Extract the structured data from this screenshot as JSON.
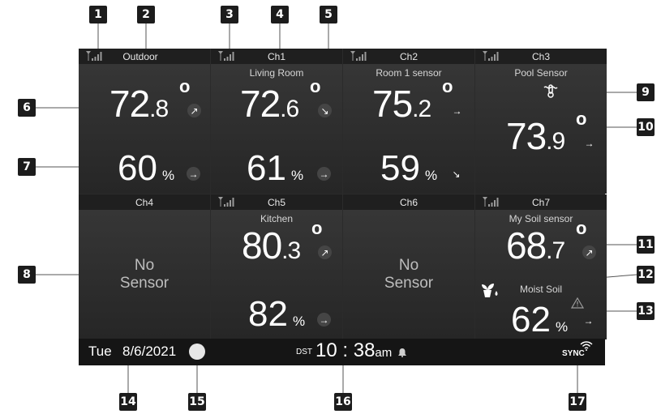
{
  "callouts": [
    "1",
    "2",
    "3",
    "4",
    "5",
    "6",
    "7",
    "8",
    "9",
    "10",
    "11",
    "12",
    "13",
    "14",
    "15",
    "16",
    "17"
  ],
  "cells": [
    {
      "channel": "Outdoor",
      "subtitle": "",
      "temp_int": "72",
      "temp_dec": ".8",
      "temp_trend": "↗",
      "hum": "60",
      "hum_unit": "%",
      "hum_trend": "→"
    },
    {
      "channel": "Ch1",
      "subtitle": "Living Room",
      "temp_int": "72",
      "temp_dec": ".6",
      "temp_trend": "↘",
      "hum": "61",
      "hum_unit": "%",
      "hum_trend": "→"
    },
    {
      "channel": "Ch2",
      "subtitle": "Room 1 sensor",
      "temp_int": "75",
      "temp_dec": ".2",
      "temp_trend": "→",
      "hum": "59",
      "hum_unit": "%",
      "hum_trend": "↘"
    },
    {
      "channel": "Ch3",
      "subtitle": "Pool Sensor",
      "temp_int": "73",
      "temp_dec": ".9",
      "temp_trend": "→"
    },
    {
      "channel": "Ch4",
      "nosensor_1": "No",
      "nosensor_2": "Sensor"
    },
    {
      "channel": "Ch5",
      "subtitle": "Kitchen",
      "temp_int": "80",
      "temp_dec": ".3",
      "temp_trend": "↗",
      "hum": "82",
      "hum_unit": "%",
      "hum_trend": "→"
    },
    {
      "channel": "Ch6",
      "nosensor_1": "No",
      "nosensor_2": "Sensor"
    },
    {
      "channel": "Ch7",
      "subtitle": "My Soil sensor",
      "temp_int": "68",
      "temp_dec": ".7",
      "temp_trend": "↗",
      "soil_label": "Moist Soil",
      "soil_val": "62",
      "soil_unit": "%",
      "soil_trend": "→"
    }
  ],
  "degree_symbol": "o",
  "status": {
    "day": "Tue",
    "date": "8/6/2021",
    "dst": "DST",
    "hour": "10",
    "sep": ":",
    "minute": "38",
    "ampm": "am",
    "sync": "SYNC"
  },
  "icons": {
    "signal": "signal-bars-icon",
    "pool": "pool-thermometer-icon",
    "plant": "plant-icon",
    "warning": "warning-icon",
    "alarm": "bell-icon",
    "wifi": "wifi-sync-icon",
    "moon": "moon-phase-icon"
  }
}
